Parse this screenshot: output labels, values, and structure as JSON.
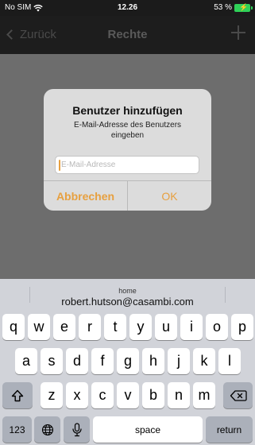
{
  "status_bar": {
    "carrier": "No SIM",
    "time": "12.26",
    "battery_text": "53 %"
  },
  "nav_bar": {
    "back_label": "Zurück",
    "title": "Rechte"
  },
  "alert": {
    "title": "Benutzer hinzufügen",
    "message": "E-Mail-Adresse des Benutzers eingeben",
    "input_placeholder": "E-Mail-Adresse",
    "input_value": "",
    "cancel_label": "Abbrechen",
    "ok_label": "OK",
    "accent_color": "#e7a040"
  },
  "keyboard": {
    "suggestion": {
      "label": "home",
      "value": "robert.hutson@casambi.com"
    },
    "row1": [
      "q",
      "w",
      "e",
      "r",
      "t",
      "y",
      "u",
      "i",
      "o",
      "p"
    ],
    "row2": [
      "a",
      "s",
      "d",
      "f",
      "g",
      "h",
      "j",
      "k",
      "l"
    ],
    "row3": [
      "z",
      "x",
      "c",
      "v",
      "b",
      "n",
      "m"
    ],
    "numbers_label": "123",
    "space_label": "space",
    "return_label": "return"
  }
}
